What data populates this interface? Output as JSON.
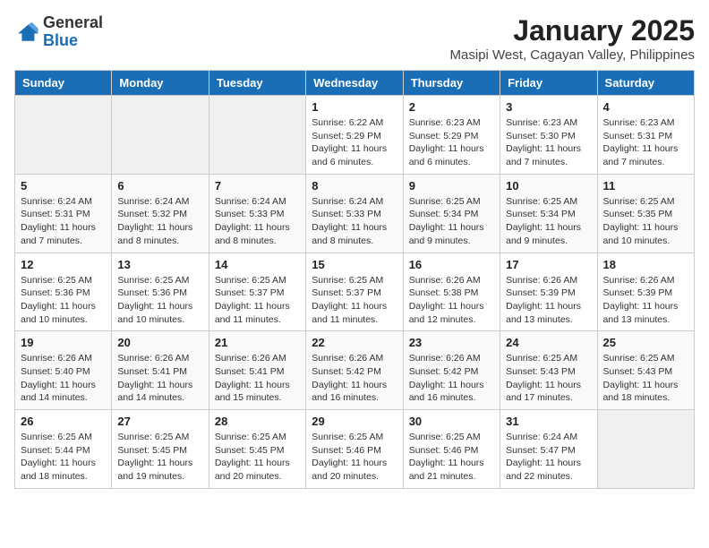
{
  "header": {
    "logo_general": "General",
    "logo_blue": "Blue",
    "month_title": "January 2025",
    "subtitle": "Masipi West, Cagayan Valley, Philippines"
  },
  "weekdays": [
    "Sunday",
    "Monday",
    "Tuesday",
    "Wednesday",
    "Thursday",
    "Friday",
    "Saturday"
  ],
  "weeks": [
    [
      {
        "day": "",
        "sunrise": "",
        "sunset": "",
        "daylight": ""
      },
      {
        "day": "",
        "sunrise": "",
        "sunset": "",
        "daylight": ""
      },
      {
        "day": "",
        "sunrise": "",
        "sunset": "",
        "daylight": ""
      },
      {
        "day": "1",
        "sunrise": "Sunrise: 6:22 AM",
        "sunset": "Sunset: 5:29 PM",
        "daylight": "Daylight: 11 hours and 6 minutes."
      },
      {
        "day": "2",
        "sunrise": "Sunrise: 6:23 AM",
        "sunset": "Sunset: 5:29 PM",
        "daylight": "Daylight: 11 hours and 6 minutes."
      },
      {
        "day": "3",
        "sunrise": "Sunrise: 6:23 AM",
        "sunset": "Sunset: 5:30 PM",
        "daylight": "Daylight: 11 hours and 7 minutes."
      },
      {
        "day": "4",
        "sunrise": "Sunrise: 6:23 AM",
        "sunset": "Sunset: 5:31 PM",
        "daylight": "Daylight: 11 hours and 7 minutes."
      }
    ],
    [
      {
        "day": "5",
        "sunrise": "Sunrise: 6:24 AM",
        "sunset": "Sunset: 5:31 PM",
        "daylight": "Daylight: 11 hours and 7 minutes."
      },
      {
        "day": "6",
        "sunrise": "Sunrise: 6:24 AM",
        "sunset": "Sunset: 5:32 PM",
        "daylight": "Daylight: 11 hours and 8 minutes."
      },
      {
        "day": "7",
        "sunrise": "Sunrise: 6:24 AM",
        "sunset": "Sunset: 5:33 PM",
        "daylight": "Daylight: 11 hours and 8 minutes."
      },
      {
        "day": "8",
        "sunrise": "Sunrise: 6:24 AM",
        "sunset": "Sunset: 5:33 PM",
        "daylight": "Daylight: 11 hours and 8 minutes."
      },
      {
        "day": "9",
        "sunrise": "Sunrise: 6:25 AM",
        "sunset": "Sunset: 5:34 PM",
        "daylight": "Daylight: 11 hours and 9 minutes."
      },
      {
        "day": "10",
        "sunrise": "Sunrise: 6:25 AM",
        "sunset": "Sunset: 5:34 PM",
        "daylight": "Daylight: 11 hours and 9 minutes."
      },
      {
        "day": "11",
        "sunrise": "Sunrise: 6:25 AM",
        "sunset": "Sunset: 5:35 PM",
        "daylight": "Daylight: 11 hours and 10 minutes."
      }
    ],
    [
      {
        "day": "12",
        "sunrise": "Sunrise: 6:25 AM",
        "sunset": "Sunset: 5:36 PM",
        "daylight": "Daylight: 11 hours and 10 minutes."
      },
      {
        "day": "13",
        "sunrise": "Sunrise: 6:25 AM",
        "sunset": "Sunset: 5:36 PM",
        "daylight": "Daylight: 11 hours and 10 minutes."
      },
      {
        "day": "14",
        "sunrise": "Sunrise: 6:25 AM",
        "sunset": "Sunset: 5:37 PM",
        "daylight": "Daylight: 11 hours and 11 minutes."
      },
      {
        "day": "15",
        "sunrise": "Sunrise: 6:25 AM",
        "sunset": "Sunset: 5:37 PM",
        "daylight": "Daylight: 11 hours and 11 minutes."
      },
      {
        "day": "16",
        "sunrise": "Sunrise: 6:26 AM",
        "sunset": "Sunset: 5:38 PM",
        "daylight": "Daylight: 11 hours and 12 minutes."
      },
      {
        "day": "17",
        "sunrise": "Sunrise: 6:26 AM",
        "sunset": "Sunset: 5:39 PM",
        "daylight": "Daylight: 11 hours and 13 minutes."
      },
      {
        "day": "18",
        "sunrise": "Sunrise: 6:26 AM",
        "sunset": "Sunset: 5:39 PM",
        "daylight": "Daylight: 11 hours and 13 minutes."
      }
    ],
    [
      {
        "day": "19",
        "sunrise": "Sunrise: 6:26 AM",
        "sunset": "Sunset: 5:40 PM",
        "daylight": "Daylight: 11 hours and 14 minutes."
      },
      {
        "day": "20",
        "sunrise": "Sunrise: 6:26 AM",
        "sunset": "Sunset: 5:41 PM",
        "daylight": "Daylight: 11 hours and 14 minutes."
      },
      {
        "day": "21",
        "sunrise": "Sunrise: 6:26 AM",
        "sunset": "Sunset: 5:41 PM",
        "daylight": "Daylight: 11 hours and 15 minutes."
      },
      {
        "day": "22",
        "sunrise": "Sunrise: 6:26 AM",
        "sunset": "Sunset: 5:42 PM",
        "daylight": "Daylight: 11 hours and 16 minutes."
      },
      {
        "day": "23",
        "sunrise": "Sunrise: 6:26 AM",
        "sunset": "Sunset: 5:42 PM",
        "daylight": "Daylight: 11 hours and 16 minutes."
      },
      {
        "day": "24",
        "sunrise": "Sunrise: 6:25 AM",
        "sunset": "Sunset: 5:43 PM",
        "daylight": "Daylight: 11 hours and 17 minutes."
      },
      {
        "day": "25",
        "sunrise": "Sunrise: 6:25 AM",
        "sunset": "Sunset: 5:43 PM",
        "daylight": "Daylight: 11 hours and 18 minutes."
      }
    ],
    [
      {
        "day": "26",
        "sunrise": "Sunrise: 6:25 AM",
        "sunset": "Sunset: 5:44 PM",
        "daylight": "Daylight: 11 hours and 18 minutes."
      },
      {
        "day": "27",
        "sunrise": "Sunrise: 6:25 AM",
        "sunset": "Sunset: 5:45 PM",
        "daylight": "Daylight: 11 hours and 19 minutes."
      },
      {
        "day": "28",
        "sunrise": "Sunrise: 6:25 AM",
        "sunset": "Sunset: 5:45 PM",
        "daylight": "Daylight: 11 hours and 20 minutes."
      },
      {
        "day": "29",
        "sunrise": "Sunrise: 6:25 AM",
        "sunset": "Sunset: 5:46 PM",
        "daylight": "Daylight: 11 hours and 20 minutes."
      },
      {
        "day": "30",
        "sunrise": "Sunrise: 6:25 AM",
        "sunset": "Sunset: 5:46 PM",
        "daylight": "Daylight: 11 hours and 21 minutes."
      },
      {
        "day": "31",
        "sunrise": "Sunrise: 6:24 AM",
        "sunset": "Sunset: 5:47 PM",
        "daylight": "Daylight: 11 hours and 22 minutes."
      },
      {
        "day": "",
        "sunrise": "",
        "sunset": "",
        "daylight": ""
      }
    ]
  ]
}
